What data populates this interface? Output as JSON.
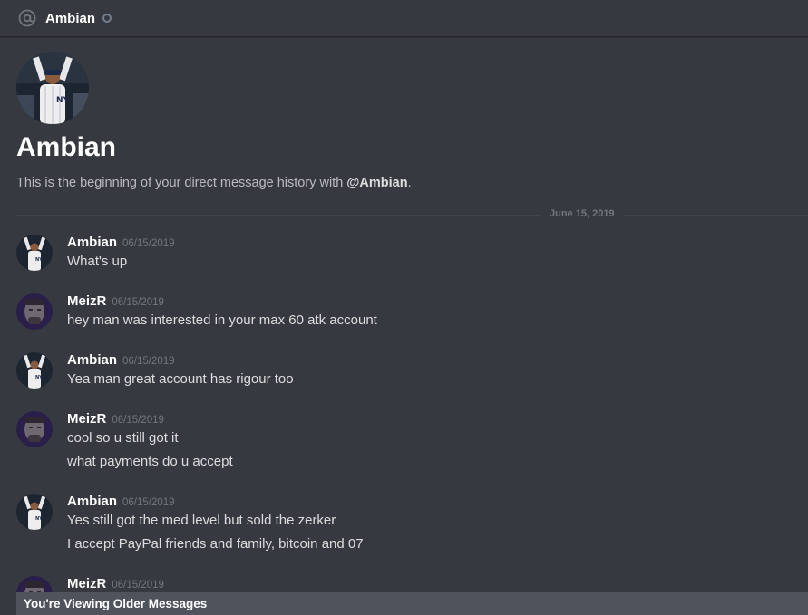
{
  "header": {
    "icon": "at-icon",
    "name": "Ambian",
    "status_icon": "offline-status-icon"
  },
  "intro": {
    "name": "Ambian",
    "text_prefix": "This is the beginning of your direct message history with ",
    "mention": "@Ambian",
    "text_suffix": "."
  },
  "divider": {
    "date": "June 15, 2019"
  },
  "messages": [
    {
      "author": "Ambian",
      "time": "06/15/2019",
      "lines": [
        "What's up"
      ]
    },
    {
      "author": "MeizR",
      "time": "06/15/2019",
      "lines": [
        "hey man was interested in your max 60 atk account"
      ]
    },
    {
      "author": "Ambian",
      "time": "06/15/2019",
      "lines": [
        "Yea man great account has rigour too"
      ]
    },
    {
      "author": "MeizR",
      "time": "06/15/2019",
      "lines": [
        "cool so u still got it",
        "what payments do u accept"
      ]
    },
    {
      "author": "Ambian",
      "time": "06/15/2019",
      "lines": [
        "Yes still got the med level but sold the zerker",
        "I accept PayPal friends and family, bitcoin and 07"
      ]
    },
    {
      "author": "MeizR",
      "time": "06/15/2019",
      "lines": []
    }
  ],
  "older_bar": {
    "label": "You're Viewing Older Messages"
  },
  "colors": {
    "background": "#36393f",
    "older_bar": "#4f545c",
    "muted": "#72767d"
  }
}
